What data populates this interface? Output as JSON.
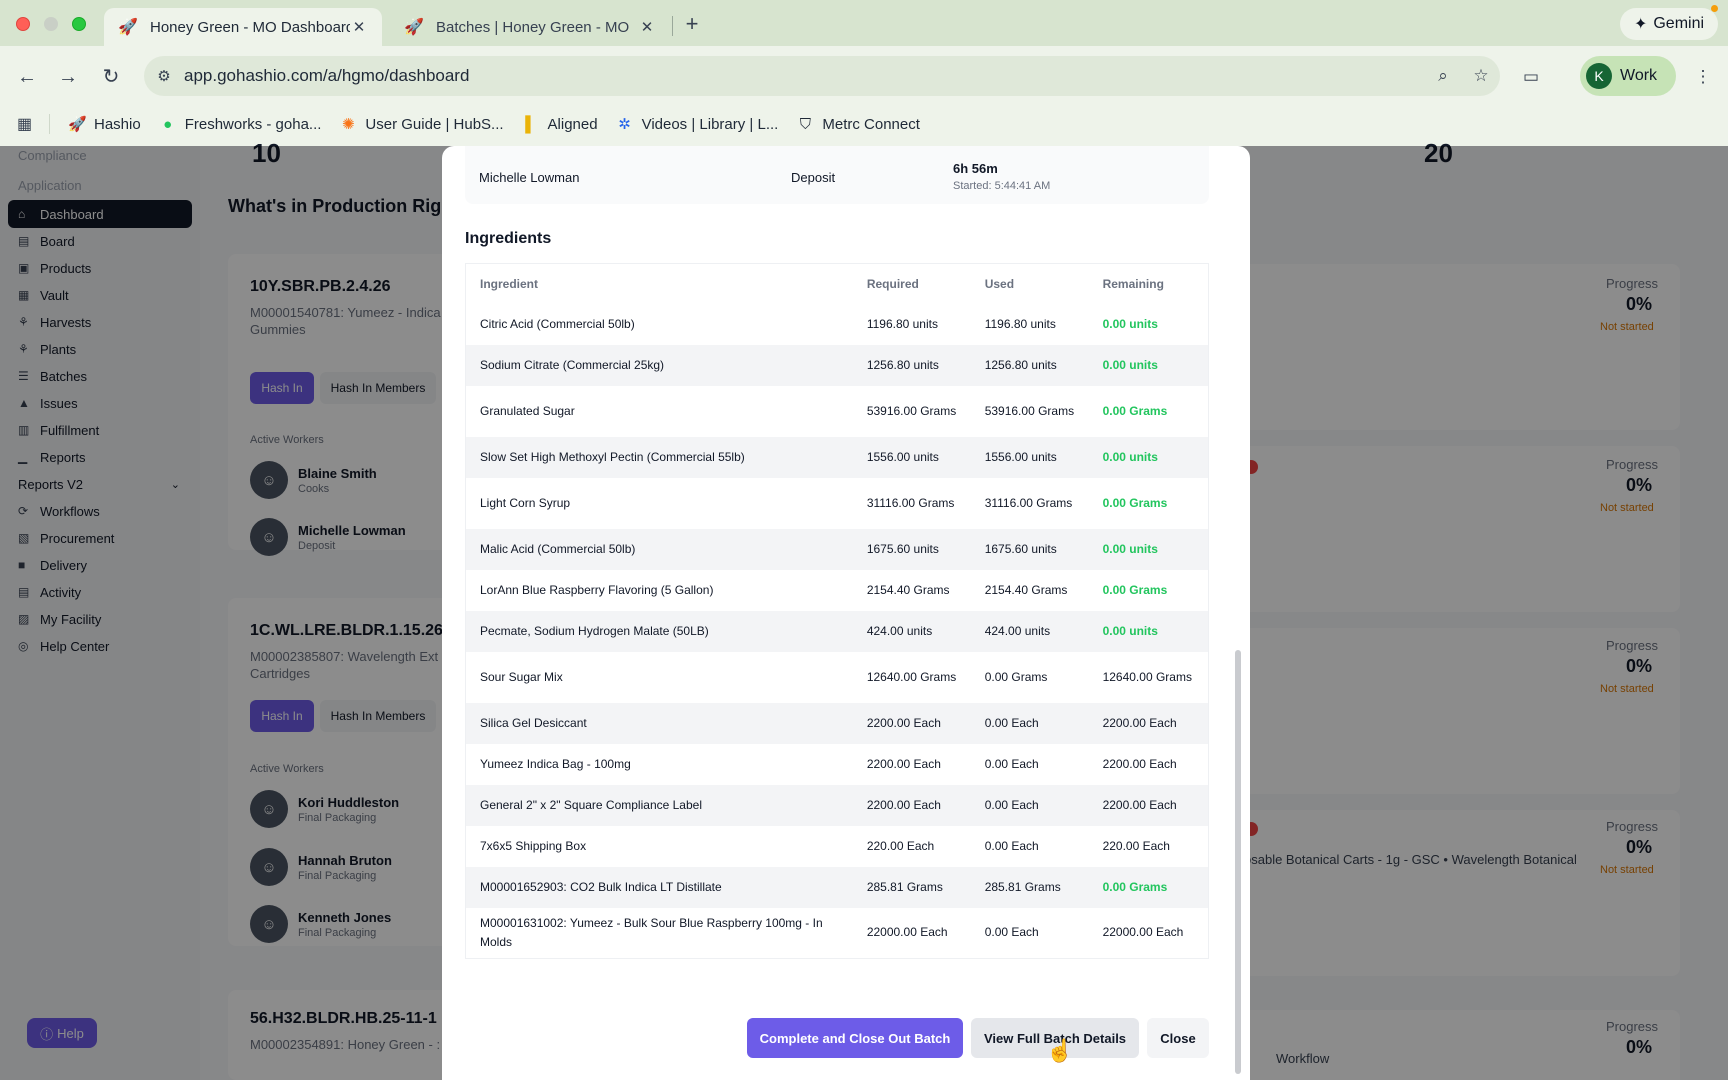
{
  "browser": {
    "tabs": [
      {
        "title": "Honey Green - MO Dashboard",
        "active": true
      },
      {
        "title": "Batches | Honey Green - MO",
        "active": false
      }
    ],
    "new_tab": "+",
    "gemini": "Gemini",
    "url": "app.gohashio.com/a/hgmo/dashboard",
    "profile": {
      "initial": "K",
      "label": "Work"
    },
    "bookmarks": [
      {
        "label": "Hashio",
        "icon": "rocket-icon"
      },
      {
        "label": "Freshworks - goha...",
        "icon": "freshworks-icon"
      },
      {
        "label": "User Guide | HubS...",
        "icon": "hubspot-icon"
      },
      {
        "label": "Aligned",
        "icon": "bars-icon"
      },
      {
        "label": "Videos | Library | L...",
        "icon": "loom-icon"
      },
      {
        "label": "Metrc Connect",
        "icon": "shield-icon"
      }
    ]
  },
  "sidebar": {
    "groups": [
      "Compliance",
      "Application"
    ],
    "items": [
      {
        "label": "Dashboard",
        "icon": "⌂",
        "active": true
      },
      {
        "label": "Board",
        "icon": "▤"
      },
      {
        "label": "Products",
        "icon": "▣"
      },
      {
        "label": "Vault",
        "icon": "▦"
      },
      {
        "label": "Harvests",
        "icon": "⚘"
      },
      {
        "label": "Plants",
        "icon": "⚘"
      },
      {
        "label": "Batches",
        "icon": "☰"
      },
      {
        "label": "Issues",
        "icon": "▲"
      },
      {
        "label": "Fulfillment",
        "icon": "▥"
      },
      {
        "label": "Reports",
        "icon": "▁"
      },
      {
        "label": "Reports V2",
        "icon": ""
      },
      {
        "label": "Workflows",
        "icon": "⟳"
      },
      {
        "label": "Procurement",
        "icon": "▧"
      },
      {
        "label": "Delivery",
        "icon": "■"
      },
      {
        "label": "Activity",
        "icon": "▤"
      },
      {
        "label": "My Facility",
        "icon": "▨"
      },
      {
        "label": "Help Center",
        "icon": "◎"
      }
    ],
    "help_button": "Help"
  },
  "dashboard": {
    "stats": [
      "10",
      "20"
    ],
    "section_title": "What's in Production Righ",
    "batches": [
      {
        "code": "10Y.SBR.PB.2.4.26",
        "desc": "M00001540781: Yumeez - Indica Gummies"
      },
      {
        "code": "1C.WL.LRE.BLDR.1.15.26",
        "desc": "M00002385807: Wavelength Ext Cartridges"
      },
      {
        "code": "56.H32.BLDR.HB.25-11-1",
        "desc": "M00002354891: Honey Green - :"
      }
    ],
    "hash_in": "Hash In",
    "hash_in_members": "Hash In Members",
    "active_workers_label": "Active Workers",
    "workers_1": [
      {
        "name": "Blaine Smith",
        "role": "Cooks"
      },
      {
        "name": "Michelle Lowman",
        "role": "Deposit"
      }
    ],
    "workers_2": [
      {
        "name": "Kori Huddleston",
        "role": "Final Packaging"
      },
      {
        "name": "Hannah Bruton",
        "role": "Final Packaging"
      },
      {
        "name": "Kenneth Jones",
        "role": "Final Packaging"
      }
    ],
    "progress_label": "Progress",
    "progress_value": "0%",
    "not_started": "Not started",
    "right_texts": [
      "osable Botanical Carts - 1g - GSC • Wavelength Botanical",
      "Workflow"
    ]
  },
  "modal": {
    "worker_row": {
      "name": "Michelle Lowman",
      "role": "Deposit",
      "time": "6h 56m",
      "started": "Started: 5:44:41 AM"
    },
    "ingredients_title": "Ingredients",
    "columns": [
      "Ingredient",
      "Required",
      "Used",
      "Remaining"
    ],
    "rows": [
      [
        "Citric Acid (Commercial 50lb)",
        "1196.80 units",
        "1196.80 units",
        "0.00 units"
      ],
      [
        "Sodium Citrate (Commercial 25kg)",
        "1256.80 units",
        "1256.80 units",
        "0.00 units"
      ],
      [
        "Granulated Sugar",
        "53916.00 Grams",
        "53916.00 Grams",
        "0.00 Grams"
      ],
      [
        "Slow Set High Methoxyl Pectin (Commercial 55lb)",
        "1556.00 units",
        "1556.00 units",
        "0.00 units"
      ],
      [
        "Light Corn Syrup",
        "31116.00 Grams",
        "31116.00 Grams",
        "0.00 Grams"
      ],
      [
        "Malic Acid (Commercial 50lb)",
        "1675.60 units",
        "1675.60 units",
        "0.00 units"
      ],
      [
        "LorAnn Blue Raspberry Flavoring (5 Gallon)",
        "2154.40 Grams",
        "2154.40 Grams",
        "0.00 Grams"
      ],
      [
        "Pecmate, Sodium Hydrogen Malate (50LB)",
        "424.00 units",
        "424.00 units",
        "0.00 units"
      ],
      [
        "Sour Sugar Mix",
        "12640.00 Grams",
        "0.00 Grams",
        "12640.00 Grams"
      ],
      [
        "Silica Gel Desiccant",
        "2200.00 Each",
        "0.00 Each",
        "2200.00 Each"
      ],
      [
        "Yumeez Indica Bag - 100mg",
        "2200.00 Each",
        "0.00 Each",
        "2200.00 Each"
      ],
      [
        "General 2\" x 2\" Square Compliance Label",
        "2200.00 Each",
        "0.00 Each",
        "2200.00 Each"
      ],
      [
        "7x6x5 Shipping Box",
        "220.00 Each",
        "0.00 Each",
        "220.00 Each"
      ],
      [
        "M00001652903: CO2 Bulk Indica LT Distillate",
        "285.81 Grams",
        "285.81 Grams",
        "0.00 Grams"
      ],
      [
        "M00001631002: Yumeez - Bulk Sour Blue Raspberry 100mg - In Molds",
        "22000.00 Each",
        "0.00 Each",
        "22000.00 Each"
      ]
    ],
    "buttons": {
      "complete": "Complete and Close Out Batch",
      "view": "View Full Batch Details",
      "close": "Close"
    }
  },
  "colors": {
    "accent": "#6d5ce8",
    "success": "#22c55e",
    "warning": "#d97706"
  }
}
